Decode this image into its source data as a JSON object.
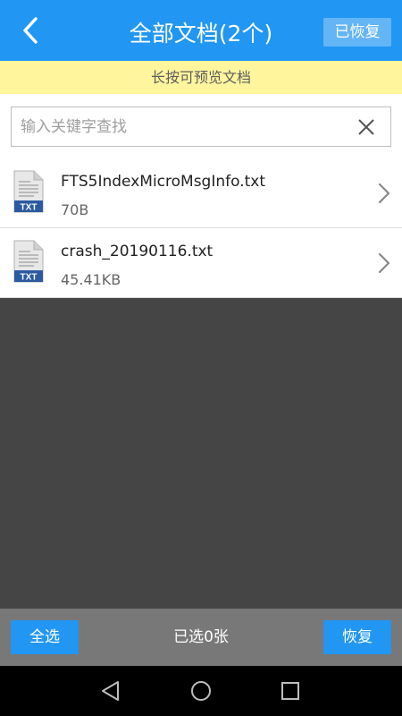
{
  "header": {
    "title": "全部文档(2个)",
    "recovered_label": "已恢复"
  },
  "hint": "长按可预览文档",
  "search": {
    "placeholder": "输入关键字查找",
    "value": ""
  },
  "files": [
    {
      "name": "FTS5IndexMicroMsgInfo.txt",
      "size": "70B",
      "type_label": "TXT",
      "icon": "txt-file-icon"
    },
    {
      "name": "crash_20190116.txt",
      "size": "45.41KB",
      "type_label": "TXT",
      "icon": "txt-file-icon"
    }
  ],
  "bottom": {
    "select_all_label": "全选",
    "selected_text": "已选0张",
    "restore_label": "恢复"
  },
  "colors": {
    "primary": "#2196f3",
    "hint_bg": "#fff59d",
    "bottom_bar": "#787878"
  },
  "icons": {
    "back": "back-arrow-icon",
    "clear": "close-icon",
    "chevron": "chevron-right-icon",
    "nav_back": "nav-back-icon",
    "nav_home": "nav-home-icon",
    "nav_recents": "nav-recents-icon"
  }
}
